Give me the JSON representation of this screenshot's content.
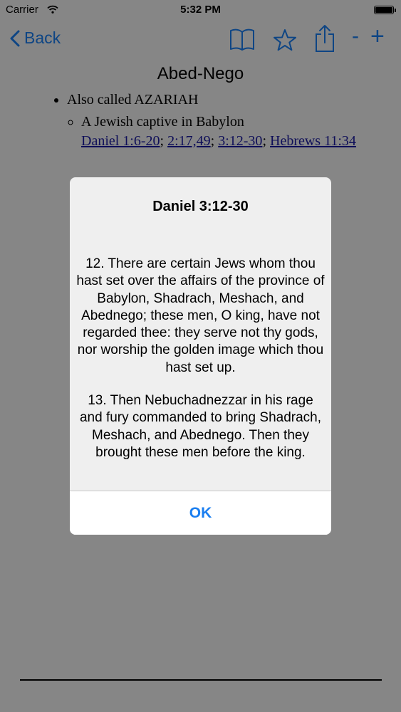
{
  "status_bar": {
    "carrier": "Carrier",
    "time": "5:32 PM"
  },
  "nav": {
    "back_label": "Back",
    "icons": [
      "book-icon",
      "star-icon",
      "share-icon"
    ],
    "minus_label": "-",
    "plus_label": "+"
  },
  "page": {
    "title": "Abed-Nego",
    "item": "Also called AZARIAH",
    "subitem": "A Jewish captive in Babylon",
    "refs": [
      {
        "label": "Daniel 1:6-20",
        "sep": "; "
      },
      {
        "label": "2:17,49",
        "sep": "; "
      },
      {
        "label": "3:12-30",
        "sep": "; "
      },
      {
        "label": "Hebrews 11:34",
        "sep": ""
      }
    ]
  },
  "alert": {
    "title": "Daniel 3:12-30",
    "verses": [
      "12. There are certain Jews whom thou hast set over the affairs of the province of Babylon, Shadrach, Meshach, and Abednego; these men, O king, have not regarded thee: they serve not thy gods, nor worship the golden image which thou hast set up.",
      "13. Then Nebuchadnezzar in his rage and fury commanded to bring Shadrach, Meshach, and Abednego. Then they brought these men before the king."
    ],
    "ok_label": "OK"
  },
  "colors": {
    "accent": "#1a7ef0",
    "link": "#1a1aa0",
    "overlay": "rgba(0,0,0,0.45)"
  }
}
